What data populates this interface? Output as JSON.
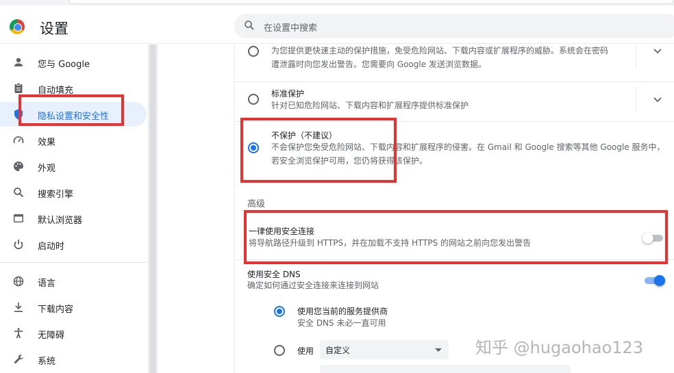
{
  "app": {
    "title": "设置"
  },
  "search": {
    "placeholder": "在设置中搜索"
  },
  "sidebar": {
    "items": [
      {
        "label": "您与 Google",
        "icon": "person-icon"
      },
      {
        "label": "自动填充",
        "icon": "clipboard-icon"
      },
      {
        "label": "隐私设置和安全性",
        "icon": "shield-icon",
        "active": true
      },
      {
        "label": "效果",
        "icon": "speedometer-icon"
      },
      {
        "label": "外观",
        "icon": "palette-icon"
      },
      {
        "label": "搜索引擎",
        "icon": "search-icon"
      },
      {
        "label": "默认浏览器",
        "icon": "browser-window-icon"
      },
      {
        "label": "启动时",
        "icon": "power-icon"
      },
      {
        "label": "语言",
        "icon": "globe-icon"
      },
      {
        "label": "下载内容",
        "icon": "download-icon"
      },
      {
        "label": "无障碍",
        "icon": "accessibility-icon"
      },
      {
        "label": "系统",
        "icon": "wrench-icon"
      }
    ]
  },
  "safe_browsing": {
    "enhanced": {
      "desc_line1": "为您提供更快速主动的保护措施，免受危险网站、下载内容或扩展程序的威胁。系统会在密码",
      "desc_line2": "遭泄露时向您发出警告。您需要向 Google 发送浏览数据。"
    },
    "standard": {
      "title": "标准保护",
      "desc": "针对已知危险网站、下载内容和扩展程序提供标准保护"
    },
    "none": {
      "title": "不保护（不建议）",
      "desc_line1": "不会保护您免受危险网站、下载内容和扩展程序的侵害。在 Gmail 和 Google 搜索等其他 Google 服务中，",
      "desc_line2": "若安全浏览保护可用，您仍将获得该保护。"
    },
    "selected": "none"
  },
  "advanced": {
    "heading": "高级",
    "https_only": {
      "title": "一律使用安全连接",
      "desc": "将导航路径升级到 HTTPS，并在加载不支持 HTTPS 的网站之前向您发出警告",
      "enabled": false
    },
    "secure_dns": {
      "title": "使用安全 DNS",
      "desc": "确定如何通过安全连接来连接到网站",
      "enabled": true,
      "current_provider": {
        "title": "使用您当前的服务提供商",
        "desc": "安全 DNS 未必一直可用"
      },
      "custom": {
        "label": "使用",
        "select_value": "自定义"
      }
    }
  },
  "colors": {
    "accent": "#1a73e8",
    "highlight_box": "#e8322f"
  },
  "watermark": "知乎 @hugaohao123"
}
